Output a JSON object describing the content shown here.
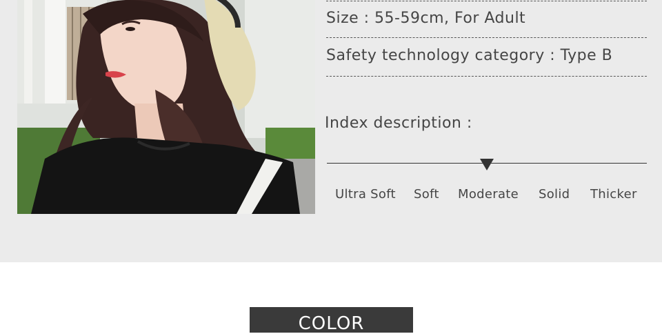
{
  "specs": {
    "size": "Size : 55-59cm, For Adult",
    "safety": "Safety technology category : Type B"
  },
  "index": {
    "label": "Index description :",
    "levels": [
      "Ultra Soft",
      "Soft",
      "Moderate",
      "Solid",
      "Thicker"
    ],
    "selected": "Moderate"
  },
  "color_section": {
    "title": "COLOR"
  }
}
